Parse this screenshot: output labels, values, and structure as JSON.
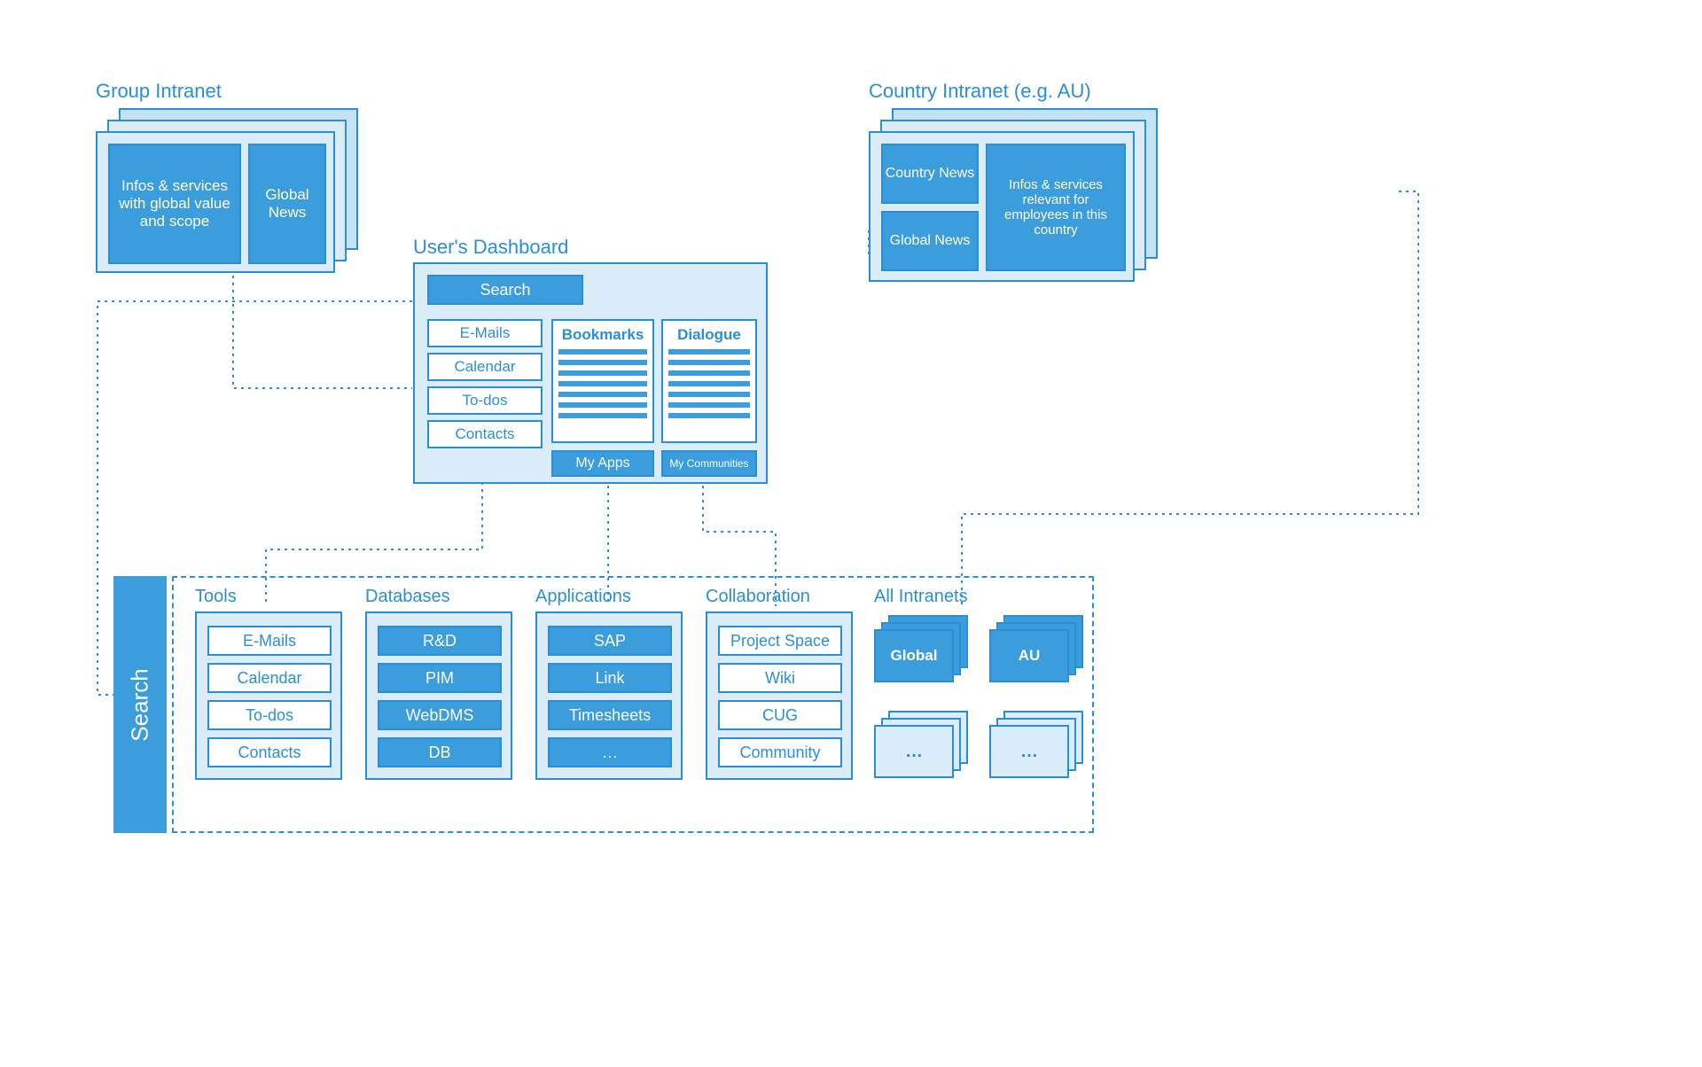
{
  "group_intranet": {
    "title": "Group Intranet",
    "infos": "Infos & services with global value and scope",
    "news": "Global News"
  },
  "country_intranet": {
    "title": "Country Intranet (e.g. AU)",
    "country_news": "Country News",
    "global_news": "Global News",
    "infos": "Infos & services relevant for employees in this country"
  },
  "dashboard": {
    "title": "User's Dashboard",
    "search": "Search",
    "left": [
      "E-Mails",
      "Calendar",
      "To-dos",
      "Contacts"
    ],
    "bookmarks": "Bookmarks",
    "dialogue": "Dialogue",
    "my_apps": "My Apps",
    "my_communities": "My Communities"
  },
  "search_label": "Search",
  "categories": {
    "tools": {
      "title": "Tools",
      "items": [
        "E-Mails",
        "Calendar",
        "To-dos",
        "Contacts"
      ],
      "style": "outline"
    },
    "databases": {
      "title": "Databases",
      "items": [
        "R&D",
        "PIM",
        "WebDMS",
        "DB"
      ],
      "style": "fill"
    },
    "applications": {
      "title": "Applications",
      "items": [
        "SAP",
        "Link",
        "Timesheets",
        "…"
      ],
      "style": "fill"
    },
    "collaboration": {
      "title": "Collaboration",
      "items": [
        "Project Space",
        "Wiki",
        "CUG",
        "Community"
      ],
      "style": "outline"
    }
  },
  "all_intranets": {
    "title": "All Intranets",
    "global": "Global",
    "au": "AU",
    "more": "…"
  }
}
